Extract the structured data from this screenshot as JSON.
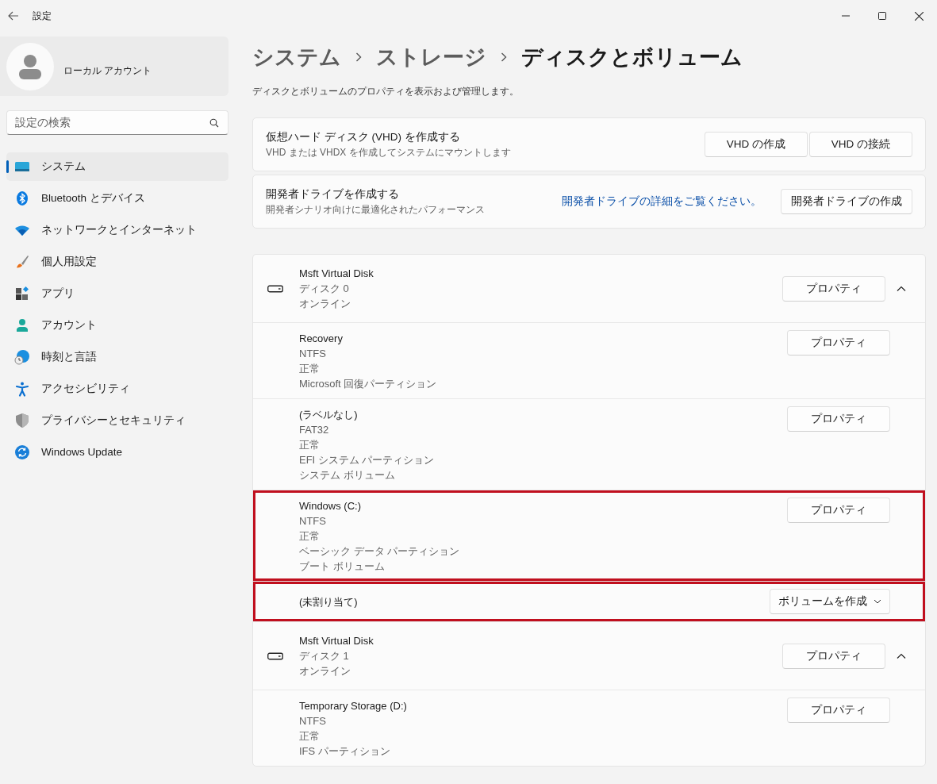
{
  "window": {
    "title": "設定"
  },
  "account": {
    "name": "ローカル アカウント"
  },
  "search": {
    "placeholder": "設定の検索"
  },
  "sidebar": {
    "items": [
      {
        "label": "システム",
        "selected": true
      },
      {
        "label": "Bluetooth とデバイス",
        "selected": false
      },
      {
        "label": "ネットワークとインターネット",
        "selected": false
      },
      {
        "label": "個人用設定",
        "selected": false
      },
      {
        "label": "アプリ",
        "selected": false
      },
      {
        "label": "アカウント",
        "selected": false
      },
      {
        "label": "時刻と言語",
        "selected": false
      },
      {
        "label": "アクセシビリティ",
        "selected": false
      },
      {
        "label": "プライバシーとセキュリティ",
        "selected": false
      },
      {
        "label": "Windows Update",
        "selected": false
      }
    ]
  },
  "breadcrumb": [
    "システム",
    "ストレージ",
    "ディスクとボリューム"
  ],
  "description": "ディスクとボリュームのプロパティを表示および管理します。",
  "action_cards": [
    {
      "title": "仮想ハード ディスク (VHD) を作成する",
      "subtitle": "VHD または VHDX を作成してシステムにマウントします",
      "buttons": [
        "VHD の作成",
        "VHD の接続"
      ]
    },
    {
      "title": "開発者ドライブを作成する",
      "subtitle": "開発者シナリオ向けに最適化されたパフォーマンス",
      "link": "開発者ドライブの詳細をご覧ください。",
      "buttons": [
        "開発者ドライブの作成"
      ]
    }
  ],
  "disks": [
    {
      "name": "Msft Virtual Disk",
      "details": [
        "ディスク 0",
        "オンライン"
      ],
      "button": "プロパティ",
      "expanded": true,
      "partitions": [
        {
          "kind": "volume",
          "name": "Recovery",
          "details": [
            "NTFS",
            "正常",
            "Microsoft 回復パーティション"
          ],
          "button": "プロパティ",
          "highlighted": false
        },
        {
          "kind": "volume",
          "name": "(ラベルなし)",
          "details": [
            "FAT32",
            "正常",
            "EFI システム パーティション",
            "システム ボリューム"
          ],
          "button": "プロパティ",
          "highlighted": false
        },
        {
          "kind": "volume",
          "name": "Windows (C:)",
          "details": [
            "NTFS",
            "正常",
            "ベーシック データ パーティション",
            "ブート ボリューム"
          ],
          "button": "プロパティ",
          "highlighted": true
        },
        {
          "kind": "unallocated",
          "name": "(未割り当て)",
          "button": "ボリュームを作成",
          "highlighted": true
        }
      ]
    },
    {
      "name": "Msft Virtual Disk",
      "details": [
        "ディスク 1",
        "オンライン"
      ],
      "button": "プロパティ",
      "expanded": true,
      "partitions": [
        {
          "kind": "volume",
          "name": "Temporary Storage (D:)",
          "details": [
            "NTFS",
            "正常",
            "IFS パーティション"
          ],
          "button": "プロパティ",
          "highlighted": false
        }
      ]
    }
  ]
}
